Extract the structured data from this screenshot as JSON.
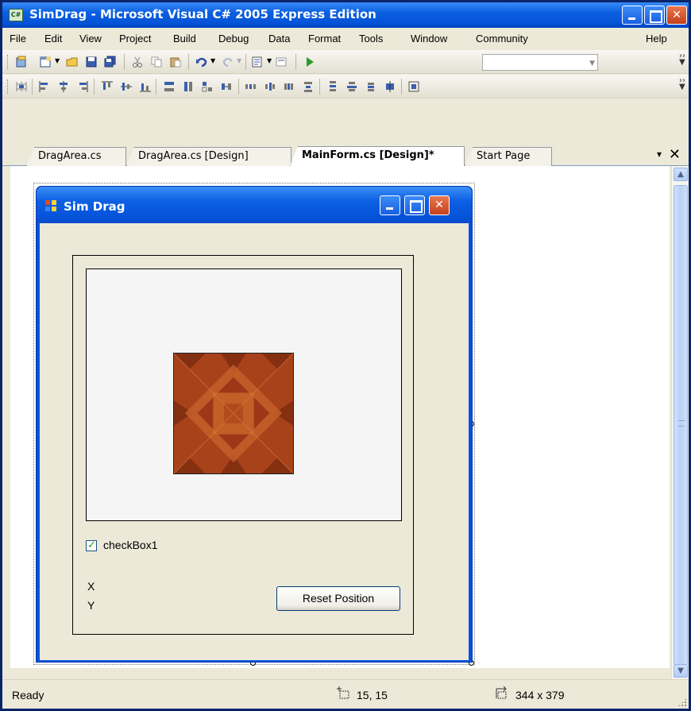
{
  "window": {
    "app_icon_text": "C#",
    "title": "SimDrag - Microsoft Visual C# 2005 Express Edition"
  },
  "menu": {
    "items": [
      "File",
      "Edit",
      "View",
      "Project",
      "Build",
      "Debug",
      "Data",
      "Format",
      "Tools",
      "Window",
      "Community",
      "Help"
    ]
  },
  "toolbar": {
    "standard_icons": [
      "new-project-icon",
      "add-item-icon",
      "open-file-icon",
      "save-icon",
      "save-all-icon",
      "cut-icon",
      "copy-icon",
      "paste-icon",
      "undo-icon",
      "redo-icon",
      "navigate-icon",
      "find-icon",
      "start-debug-icon"
    ],
    "solution_config_value": "",
    "layout_icons": [
      "align-to-grid-icon",
      "align-lefts-icon",
      "align-centers-icon",
      "align-rights-icon",
      "align-tops-icon",
      "align-middles-icon",
      "align-bottoms-icon",
      "make-same-width-icon",
      "size-to-grid-icon",
      "make-same-size-icon",
      "horizontal-spacing-icon",
      "increase-h-spacing-icon",
      "decrease-h-spacing-icon",
      "remove-h-spacing-icon",
      "vertical-spacing-icon",
      "increase-v-spacing-icon",
      "decrease-v-spacing-icon",
      "remove-v-spacing-icon",
      "center-horizontally-icon"
    ]
  },
  "tabs": {
    "items": [
      {
        "label": "DragArea.cs",
        "active": false
      },
      {
        "label": "DragArea.cs [Design]",
        "active": false
      },
      {
        "label": "MainForm.cs [Design]*",
        "active": true
      },
      {
        "label": "Start Page",
        "active": false
      }
    ],
    "dropdown_glyph": "▾",
    "close_glyph": "✕"
  },
  "form": {
    "title": "Sim Drag",
    "checkbox_label": "checkBox1",
    "checkbox_checked": true,
    "label_x": "X",
    "label_y": "Y",
    "reset_button": "Reset Position"
  },
  "statusbar": {
    "status": "Ready",
    "location": "15, 15",
    "size": "344 x 379"
  },
  "colors": {
    "xp_blue": "#0752dd",
    "close_red": "#c4401a",
    "tile_base": "#b0461d",
    "tile_accent": "#8a2a12"
  }
}
